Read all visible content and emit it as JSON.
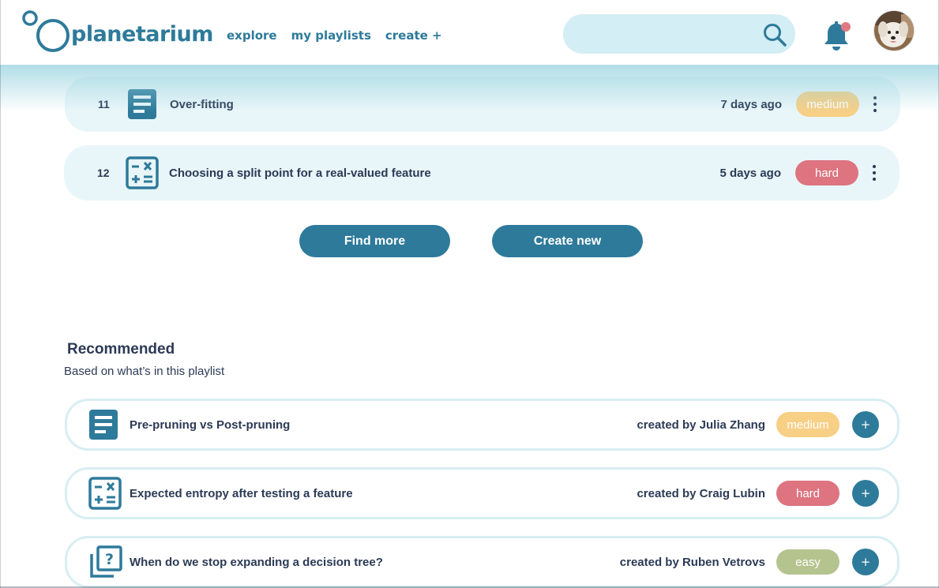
{
  "brand": {
    "name": "planetarium",
    "color": "#2e7a9a"
  },
  "nav": {
    "explore": "explore",
    "my_playlists": "my playlists",
    "create": "create +"
  },
  "search": {
    "placeholder": "",
    "value": ""
  },
  "notifications": {
    "has_unread": true,
    "dot_color": "#e07a82"
  },
  "playlist_items": [
    {
      "number": "11",
      "icon": "document-icon",
      "title": "Over-fitting",
      "time": "7 days ago",
      "difficulty": "medium"
    },
    {
      "number": "12",
      "icon": "calculator-icon",
      "title": "Choosing a split point for a real-valued feature",
      "time": "5 days ago",
      "difficulty": "hard"
    }
  ],
  "actions": {
    "find_more": "Find more",
    "create_new": "Create new"
  },
  "recommended": {
    "title": "Recommended",
    "subtitle": "Based on what’s in this playlist",
    "items": [
      {
        "icon": "document-icon",
        "title": "Pre-pruning vs Post-pruning",
        "author": "created by Julia Zhang",
        "difficulty": "medium"
      },
      {
        "icon": "calculator-icon",
        "title": "Expected entropy after testing a feature",
        "author": "created by Craig Lubin",
        "difficulty": "hard"
      },
      {
        "icon": "question-cards-icon",
        "title": "When do we stop expanding a decision tree?",
        "author": "created by Ruben Vetrovs",
        "difficulty": "easy"
      }
    ],
    "add_label": "+"
  },
  "difficulty_colors": {
    "easy": "#b5c48f",
    "medium": "#f7cf85",
    "hard": "#dd7480"
  }
}
